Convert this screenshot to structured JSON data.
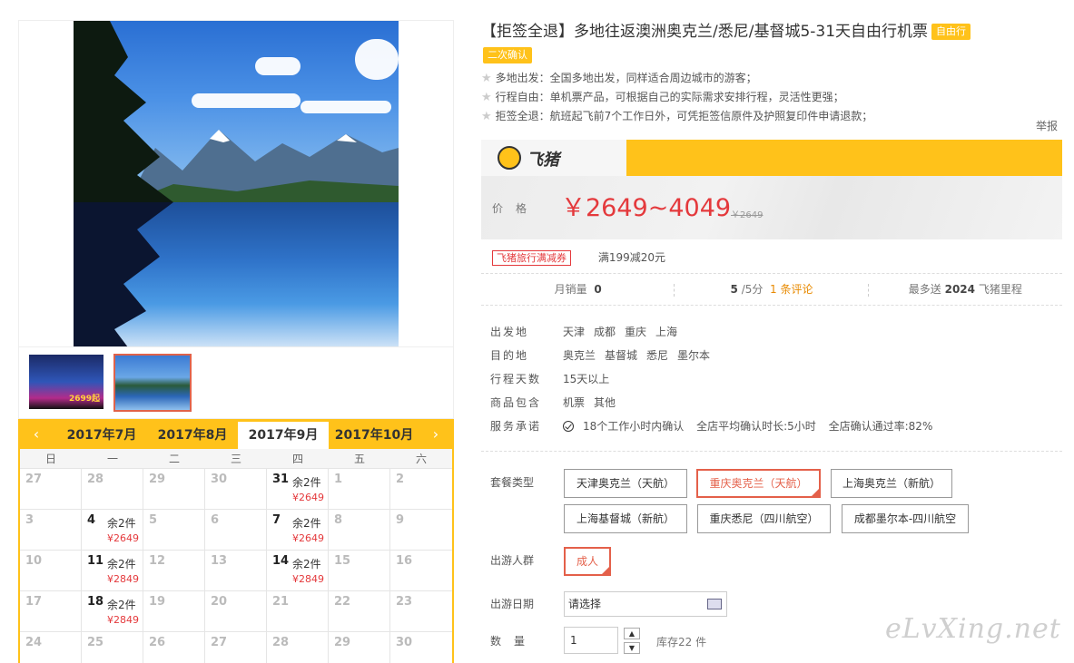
{
  "product": {
    "title": "【拒签全退】多地往返澳洲奥克兰/悉尼/基督城5-31天自由行机票",
    "badge1": "自由行",
    "badge2": "二次确认",
    "features": [
      "多地出发：全国多地出发，同样适合周边城市的游客；",
      "行程自由：单机票产品，可根据自己的实际需求安排行程，灵活性更强；",
      "拒签全退：航班起飞前7个工作日外，可凭拒签信原件及护照复印件申请退款；"
    ],
    "report": "举报"
  },
  "thumb_price": "2699起",
  "brand": {
    "name": "飞猪",
    "accent": "#ffc21a"
  },
  "price": {
    "label": "价格",
    "value": "￥2649~4049",
    "original": "￥2649"
  },
  "coupon": {
    "tag": "飞猪旅行满减券",
    "text": "满199减20元"
  },
  "stats": {
    "monthly_label": "月销量",
    "monthly_value": "0",
    "rating_value": "5",
    "rating_suffix": "/5分",
    "reviews": "1 条评论",
    "mileage_prefix": "最多送",
    "mileage_value": "2024",
    "mileage_suffix": "飞猪里程"
  },
  "info": {
    "depart_label": "出发地",
    "depart": [
      "天津",
      "成都",
      "重庆",
      "上海"
    ],
    "dest_label": "目的地",
    "dest": [
      "奥克兰",
      "基督城",
      "悉尼",
      "墨尔本"
    ],
    "days_label": "行程天数",
    "days": "15天以上",
    "includes_label": "商品包含",
    "includes": [
      "机票",
      "其他"
    ],
    "service_label": "服务承诺",
    "service": [
      "18个工作小时内确认",
      "全店平均确认时长:5小时",
      "全店确认通过率:82%"
    ]
  },
  "options": {
    "package_label": "套餐类型",
    "packages": [
      "天津奥克兰（天航）",
      "重庆奥克兰（天航）",
      "上海奥克兰（新航）",
      "上海基督城（新航）",
      "重庆悉尼（四川航空）",
      "成都墨尔本-四川航空"
    ],
    "selected_package": "重庆奥克兰（天航）",
    "group_label": "出游人群",
    "group": "成人",
    "date_label": "出游日期",
    "date_placeholder": "请选择",
    "qty_label": "数量",
    "qty_value": "1",
    "stock": "库存22 件"
  },
  "calendar": {
    "months": [
      "2017年7月",
      "2017年8月",
      "2017年9月",
      "2017年10月"
    ],
    "active_month": "2017年9月",
    "weekdays": [
      "日",
      "一",
      "二",
      "三",
      "四",
      "五",
      "六"
    ],
    "days": [
      {
        "d": "27"
      },
      {
        "d": "28"
      },
      {
        "d": "29"
      },
      {
        "d": "30"
      },
      {
        "d": "31",
        "rem": "余2件",
        "price": "¥2649"
      },
      {
        "d": "1"
      },
      {
        "d": "2"
      },
      {
        "d": "3"
      },
      {
        "d": "4",
        "rem": "余2件",
        "price": "¥2649"
      },
      {
        "d": "5"
      },
      {
        "d": "6"
      },
      {
        "d": "7",
        "rem": "余2件",
        "price": "¥2649"
      },
      {
        "d": "8"
      },
      {
        "d": "9"
      },
      {
        "d": "10"
      },
      {
        "d": "11",
        "rem": "余2件",
        "price": "¥2849"
      },
      {
        "d": "12"
      },
      {
        "d": "13"
      },
      {
        "d": "14",
        "rem": "余2件",
        "price": "¥2849"
      },
      {
        "d": "15"
      },
      {
        "d": "16"
      },
      {
        "d": "17"
      },
      {
        "d": "18",
        "rem": "余2件",
        "price": "¥2849"
      },
      {
        "d": "19"
      },
      {
        "d": "20"
      },
      {
        "d": "21"
      },
      {
        "d": "22"
      },
      {
        "d": "23"
      },
      {
        "d": "24"
      },
      {
        "d": "25"
      },
      {
        "d": "26"
      },
      {
        "d": "27"
      },
      {
        "d": "28"
      },
      {
        "d": "29"
      },
      {
        "d": "30"
      }
    ],
    "accent": "#ffc21a",
    "price_color": "#e4393c"
  },
  "watermark": "eLvXing.net"
}
